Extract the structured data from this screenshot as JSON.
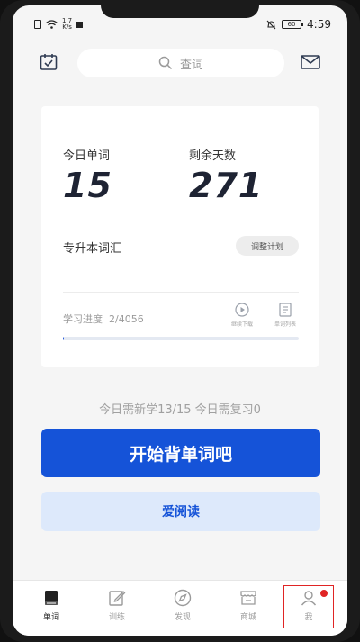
{
  "status_bar": {
    "speed_top": "1.7",
    "speed_bottom": "K/s",
    "battery": "60",
    "time": "4:59"
  },
  "search": {
    "placeholder": "查词"
  },
  "plan": {
    "today_words_label": "今日单词",
    "today_words_value": "15",
    "days_left_label": "剩余天数",
    "days_left_value": "271",
    "book_name": "专升本词汇",
    "adjust_label": "调整计划",
    "progress_label": "学习进度",
    "progress_value": "2/4056",
    "progress_fraction": 0.0005,
    "continue_download_label": "继续下载",
    "word_list_label": "单词列表"
  },
  "summary": "今日需新学13/15  今日需复习0",
  "start_button": "开始背单词吧",
  "read_button": "爱阅读",
  "tabs": [
    {
      "label": "单词",
      "icon": "book-icon",
      "active": true
    },
    {
      "label": "训练",
      "icon": "edit-icon",
      "active": false
    },
    {
      "label": "发现",
      "icon": "compass-icon",
      "active": false
    },
    {
      "label": "商城",
      "icon": "store-icon",
      "active": false
    },
    {
      "label": "我",
      "icon": "user-icon",
      "active": false
    }
  ],
  "colors": {
    "accent": "#1553d8",
    "light_accent": "#dde9fb",
    "badge": "#e02424"
  }
}
